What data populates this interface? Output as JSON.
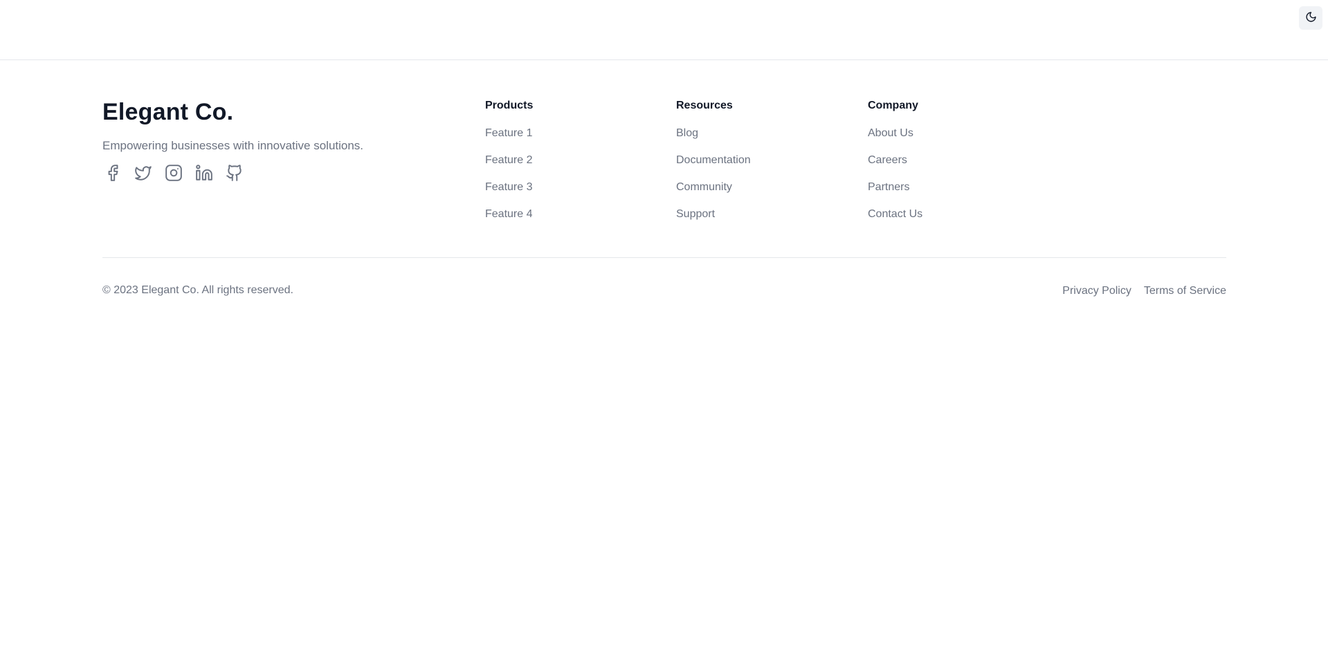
{
  "header": {
    "theme_toggle_icon": "moon-icon"
  },
  "footer": {
    "brand": {
      "name": "Elegant Co.",
      "tagline": "Empowering businesses with innovative solutions."
    },
    "social": [
      {
        "icon": "facebook-icon"
      },
      {
        "icon": "twitter-icon"
      },
      {
        "icon": "instagram-icon"
      },
      {
        "icon": "linkedin-icon"
      },
      {
        "icon": "github-icon"
      }
    ],
    "columns": [
      {
        "heading": "Products",
        "links": [
          "Feature 1",
          "Feature 2",
          "Feature 3",
          "Feature 4"
        ]
      },
      {
        "heading": "Resources",
        "links": [
          "Blog",
          "Documentation",
          "Community",
          "Support"
        ]
      },
      {
        "heading": "Company",
        "links": [
          "About Us",
          "Careers",
          "Partners",
          "Contact Us"
        ]
      }
    ],
    "copyright": "© 2023 Elegant Co. All rights reserved.",
    "legal": [
      "Privacy Policy",
      "Terms of Service"
    ]
  },
  "colors": {
    "text_primary": "#111827",
    "text_muted": "#6b7280",
    "divider": "#e5e7eb",
    "toggle_background": "#f1f3f6"
  }
}
